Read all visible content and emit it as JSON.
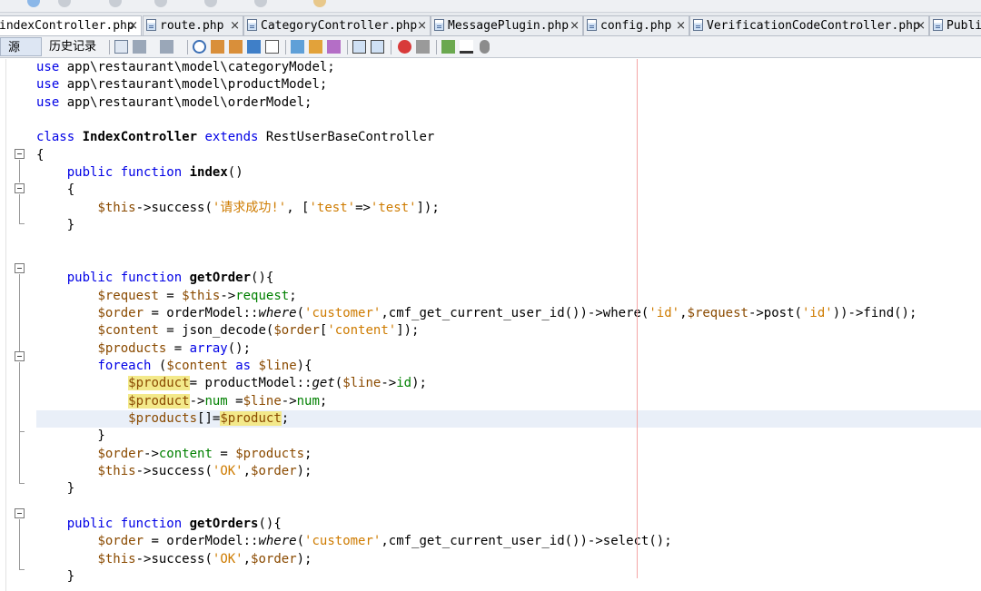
{
  "tabs": [
    {
      "label": "indexController.php",
      "active": true
    },
    {
      "label": "route.php",
      "active": false
    },
    {
      "label": "CategoryController.php",
      "active": false
    },
    {
      "label": "MessagePlugin.php",
      "active": false
    },
    {
      "label": "config.php",
      "active": false
    },
    {
      "label": "VerificationCodeController.php",
      "active": false
    },
    {
      "label": "Publi",
      "active": false
    }
  ],
  "close_glyph": "×",
  "editor_toolbar": {
    "source_label": "源",
    "history_label": "历史记录"
  },
  "code_lines": [
    "use app\\restaurant\\model\\categoryModel;",
    "use app\\restaurant\\model\\productModel;",
    "use app\\restaurant\\model\\orderModel;",
    "",
    "class IndexController extends RestUserBaseController",
    "{",
    "    public function index()",
    "    {",
    "        $this->success('请求成功!', ['test'=>'test']);",
    "    }",
    "",
    "",
    "    public function getOrder(){",
    "        $request = $this->request;",
    "        $order = orderModel::where('customer',cmf_get_current_user_id())->where('id',$request->post('id'))->find();",
    "        $content = json_decode($order['content']);",
    "        $products = array();",
    "        foreach ($content as $line){",
    "            $product= productModel::get($line->id);",
    "            $product->num =$line->num;",
    "            $products[]=$product;",
    "        }",
    "        $order->content = $products;",
    "        $this->success('OK',$order);",
    "    }",
    "",
    "    public function getOrders(){",
    "        $order = orderModel::where('customer',cmf_get_current_user_id())->select();",
    "        $this->success('OK',$order);",
    "    }"
  ],
  "current_line_index": 20,
  "colors": {
    "keyword": "#0000e6",
    "variable": "#8a4a00",
    "string": "#ce7b00",
    "property": "#008000",
    "highlight": "#f3e98a",
    "current_line": "#e9eff8",
    "right_margin": "#f4a6a6"
  }
}
